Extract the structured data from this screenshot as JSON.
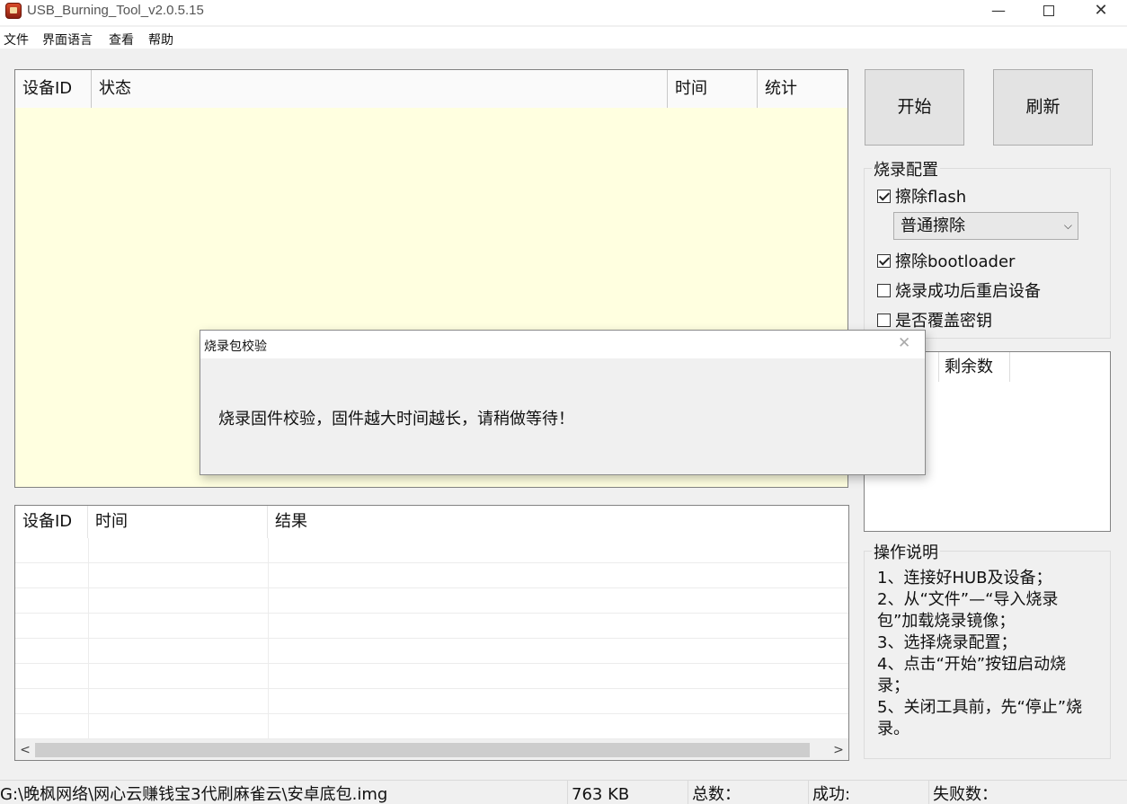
{
  "window": {
    "title": "USB_Burning_Tool_v2.0.5.15",
    "minimize_glyph": "—",
    "close_glyph": "✕"
  },
  "menu": [
    "文件",
    "界面语言",
    "查看",
    "帮助"
  ],
  "device_table": {
    "columns": [
      "设备ID",
      "状态",
      "时间",
      "统计"
    ],
    "background": "#ffffe0"
  },
  "buttons": {
    "start": "开始",
    "refresh": "刷新"
  },
  "burn_config": {
    "title": "烧录配置",
    "erase_flash": {
      "label": "擦除flash",
      "checked": true
    },
    "erase_mode": "普通擦除",
    "erase_bootloader": {
      "label": "擦除bootloader",
      "checked": true
    },
    "reboot_after": {
      "label": "烧录成功后重启设备",
      "checked": false
    },
    "overwrite_key": {
      "label": "是否覆盖密钥",
      "checked": false
    }
  },
  "remaining": {
    "column": "剩余数"
  },
  "instructions": {
    "title": "操作说明",
    "lines": [
      "1、连接好HUB及设备；",
      "2、从“文件”—“导入烧录包”加载烧录镜像；",
      "3、选择烧录配置；",
      "4、点击“开始”按钮启动烧录；",
      "5、关闭工具前，先“停止”烧录。"
    ]
  },
  "result_table": {
    "columns": [
      "设备ID",
      "时间",
      "结果"
    ],
    "scroll_left": "<",
    "scroll_right": ">"
  },
  "status_bar": {
    "path": "G:\\晚枫网络\\网心云赚钱宝3代刷麻雀云\\安卓底包.img",
    "size": "763 KB",
    "total": "总数：",
    "success": "成功:",
    "fail": "失败数："
  },
  "dialog": {
    "title": "烧录包校验",
    "message": "烧录固件校验，固件越大时间越长，请稍做等待！",
    "close_glyph": "✕"
  }
}
